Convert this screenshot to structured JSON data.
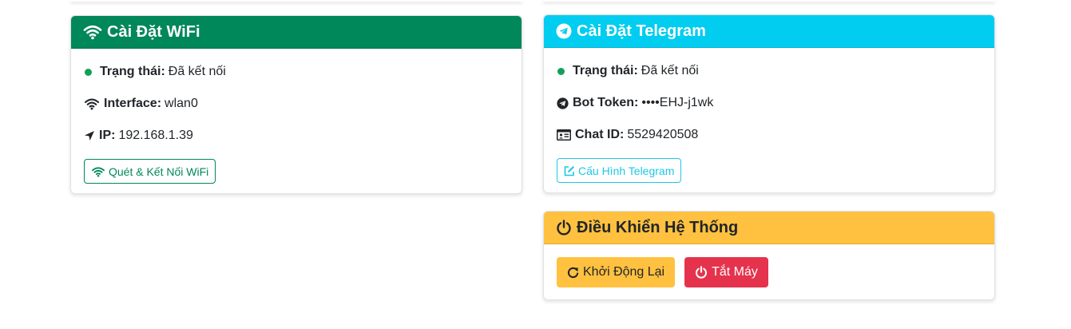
{
  "wifi_card": {
    "title": "Cài Đặt WiFi",
    "status_label": "Trạng thái:",
    "status_value": "Đã kết nối",
    "interface_label": "Interface:",
    "interface_value": "wlan0",
    "ip_label": "IP:",
    "ip_value": "192.168.1.39",
    "scan_button": "Quét & Kết Nối WiFi"
  },
  "telegram_card": {
    "title": "Cài Đặt Telegram",
    "status_label": "Trạng thái:",
    "status_value": "Đã kết nối",
    "token_label": "Bot Token:",
    "token_value": "••••EHJ-j1wk",
    "chat_label": "Chat ID:",
    "chat_value": "5529420508",
    "config_button": "Cấu Hình Telegram"
  },
  "system_card": {
    "title": "Điều Khiển Hệ Thống",
    "restart_button": "Khởi Động Lại",
    "shutdown_button": "Tắt Máy"
  },
  "colors": {
    "success": "#00875a",
    "info": "#00cdf0",
    "warning": "#ffc13f",
    "danger": "#e5334d",
    "status_dot": "#11a05a"
  },
  "icons": {
    "wifi": "wifi-icon",
    "telegram": "telegram-icon",
    "location": "location-arrow-icon",
    "id_card": "id-card-icon",
    "edit": "edit-icon",
    "power": "power-icon",
    "refresh": "refresh-icon"
  }
}
